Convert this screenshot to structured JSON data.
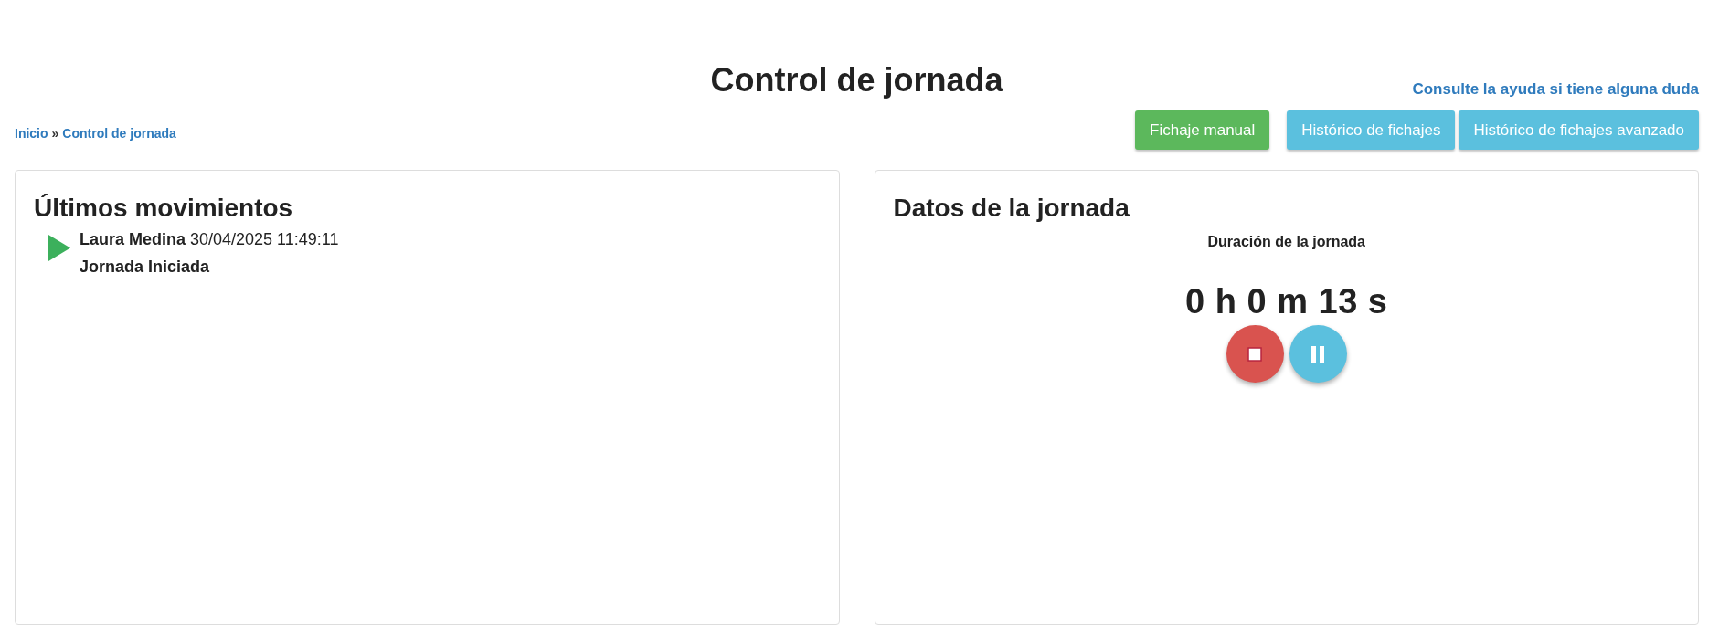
{
  "page": {
    "title": "Control de jornada",
    "help_link": "Consulte la ayuda si tiene alguna duda"
  },
  "breadcrumb": {
    "separator": "»",
    "items": [
      {
        "label": "Inicio"
      },
      {
        "label": "Control de jornada"
      }
    ]
  },
  "actions": [
    {
      "label": "Fichaje manual",
      "kind": "success"
    },
    {
      "label": "Histórico de fichajes",
      "kind": "info"
    },
    {
      "label": "Histórico de fichajes avanzado",
      "kind": "info"
    }
  ],
  "movements_panel": {
    "title": "Últimos movimientos",
    "entries": [
      {
        "kind": "start",
        "line": "**Laura Medina** 30/04/2025 11:49:11",
        "event": "Jornada Iniciada"
      }
    ]
  },
  "workday_panel": {
    "title": "Datos de la jornada",
    "duration_label": "Duración de la jornada",
    "duration": "0 h 0 m 13 s",
    "controls": [
      {
        "kind": "stop"
      },
      {
        "kind": "pause"
      }
    ]
  }
}
